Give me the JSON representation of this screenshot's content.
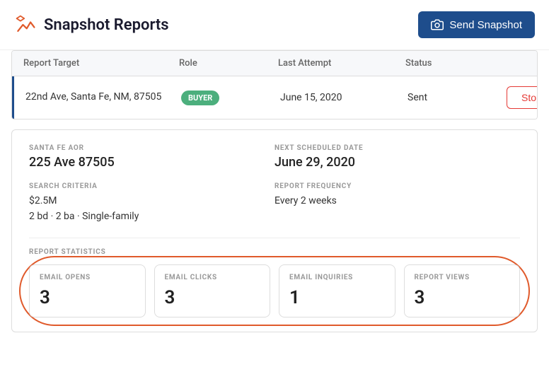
{
  "header": {
    "title": "Snapshot Reports",
    "send_snapshot_label": "Send Snapshot"
  },
  "table": {
    "columns": [
      "Report Target",
      "Role",
      "Last Attempt",
      "Status",
      ""
    ],
    "row": {
      "report_target": "22nd Ave, Santa Fe, NM, 87505",
      "role": "BUYER",
      "last_attempt": "June 15, 2020",
      "status": "Sent",
      "stop_label": "Stop"
    }
  },
  "detail": {
    "aor_label": "SANTA FE AOR",
    "aor_value": "225 Ave 87505",
    "next_date_label": "NEXT SCHEDULED DATE",
    "next_date_value": "June 29, 2020",
    "search_criteria_label": "SEARCH CRITERIA",
    "search_criteria_value": "$2.5M",
    "search_criteria_sub": "2 bd · 2 ba · Single-family",
    "report_frequency_label": "REPORT FREQUENCY",
    "report_frequency_value": "Every 2 weeks",
    "stats_label": "REPORT STATISTICS",
    "stats": [
      {
        "label": "EMAIL OPENS",
        "value": "3"
      },
      {
        "label": "EMAIL CLICKS",
        "value": "3"
      },
      {
        "label": "EMAIL INQUIRIES",
        "value": "1"
      },
      {
        "label": "REPORT VIEWS",
        "value": "3"
      }
    ]
  }
}
